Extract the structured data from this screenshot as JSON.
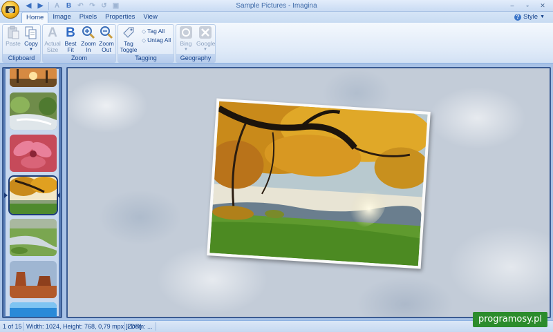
{
  "window": {
    "title": "Sample Pictures - Imagina",
    "controls": [
      "–",
      "▫",
      "✕"
    ]
  },
  "quick_access": [
    {
      "icon": "back-arrow-icon",
      "glyph": "◀"
    },
    {
      "icon": "forward-arrow-icon",
      "glyph": "▶"
    },
    {
      "icon": "actual-size-small-icon",
      "glyph": "A"
    },
    {
      "icon": "best-fit-small-icon",
      "glyph": "B"
    },
    {
      "icon": "rotate-left-icon",
      "glyph": "↶"
    },
    {
      "icon": "rotate-right-icon",
      "glyph": "↷"
    },
    {
      "icon": "undo-icon",
      "glyph": "↺"
    },
    {
      "icon": "save-icon",
      "glyph": "▣"
    }
  ],
  "tabs": [
    {
      "label": "Home",
      "active": true
    },
    {
      "label": "Image",
      "active": false
    },
    {
      "label": "Pixels",
      "active": false
    },
    {
      "label": "Properties",
      "active": false
    },
    {
      "label": "View",
      "active": false
    }
  ],
  "style_menu": {
    "label": "Style",
    "help_glyph": "?"
  },
  "ribbon": {
    "clipboard": {
      "label": "Clipboard",
      "paste": {
        "line1": "Paste",
        "enabled": false
      },
      "copy": {
        "line1": "Copy",
        "enabled": true
      }
    },
    "zoom": {
      "label": "Zoom",
      "actual_size": {
        "line1": "Actual",
        "line2": "Size",
        "enabled": false
      },
      "best_fit": {
        "line1": "Best",
        "line2": "Fit",
        "enabled": true
      },
      "zoom_in": {
        "line1": "Zoom",
        "line2": "In",
        "enabled": true
      },
      "zoom_out": {
        "line1": "Zoom",
        "line2": "Out",
        "enabled": true
      }
    },
    "tagging": {
      "label": "Tagging",
      "tag_toggle": {
        "line1": "Tag",
        "line2": "Toggle"
      },
      "tag_all": "Tag All",
      "untag_all": "Untag All"
    },
    "geography": {
      "label": "Geography",
      "bing": {
        "line1": "Bing",
        "enabled": false
      },
      "google": {
        "line1": "Google",
        "enabled": false
      }
    }
  },
  "thumbnails": [
    {
      "subject": "sunset trees",
      "selected": false
    },
    {
      "subject": "waterfall ferns",
      "selected": false
    },
    {
      "subject": "red plant",
      "selected": false
    },
    {
      "subject": "autumn tree",
      "selected": true
    },
    {
      "subject": "river meadow",
      "selected": false
    },
    {
      "subject": "desert rocks",
      "selected": false
    },
    {
      "subject": "blue water",
      "selected": false
    }
  ],
  "colors": {
    "ribbon_text": "#15428b",
    "frame_border": "#3a5b92",
    "watermark_bg": "#2c8c2c"
  },
  "status": {
    "position": "1 of 15",
    "info": "Width: 1024, Height: 768, 0,79 mpx [LDR]",
    "zoom": "Zoom: ..."
  },
  "watermark": "programosy.pl"
}
